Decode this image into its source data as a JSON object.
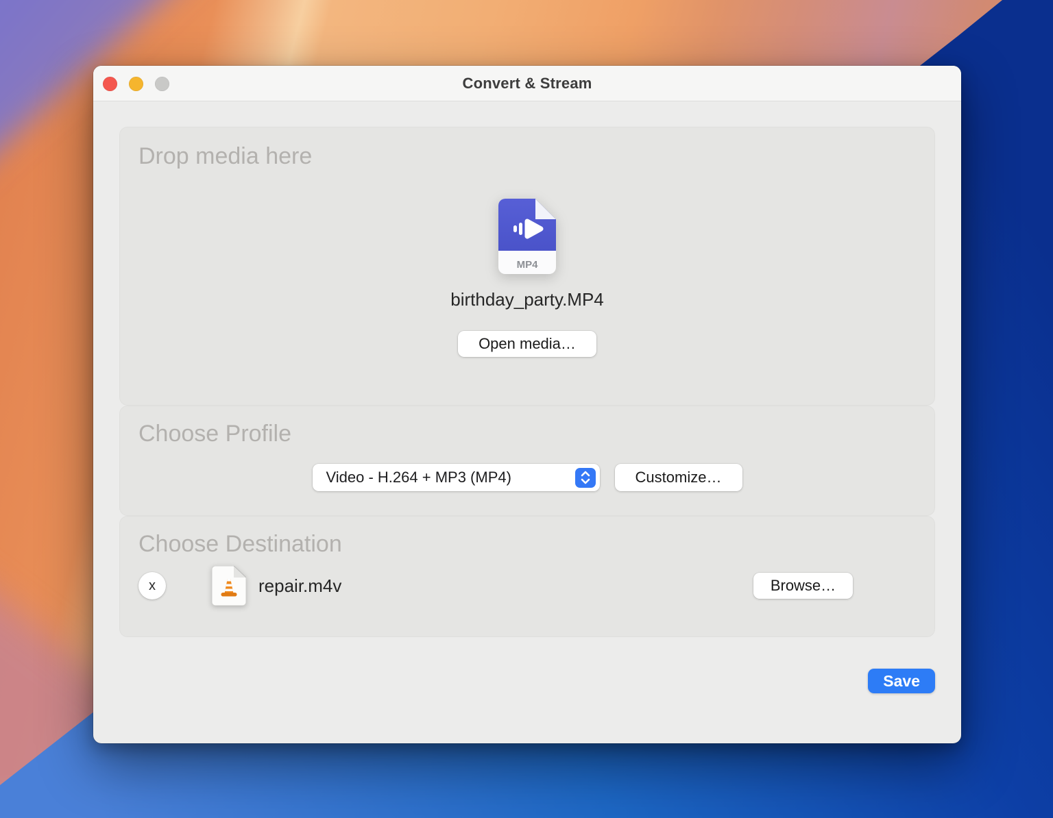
{
  "window": {
    "title": "Convert & Stream"
  },
  "drop_zone": {
    "heading": "Drop media here",
    "file_icon_label": "MP4",
    "file_name": "birthday_party.MP4",
    "open_media_label": "Open media…"
  },
  "profile": {
    "heading": "Choose Profile",
    "selected_option": "Video - H.264 + MP3 (MP4)",
    "customize_label": "Customize…"
  },
  "destination": {
    "heading": "Choose Destination",
    "remove_label": "x",
    "file_name": "repair.m4v",
    "browse_label": "Browse…"
  },
  "footer": {
    "save_label": "Save"
  },
  "colors": {
    "accent_blue": "#2d7cf6",
    "stepper_blue": "#3478f6",
    "mp4_icon_blue": "#4f58cf",
    "vlc_cone_orange": "#ef8a1e",
    "traffic_red": "#f4574e",
    "traffic_yellow": "#f5b52e",
    "traffic_gray": "#c9c9c7",
    "panel_gray": "#e5e5e3",
    "titlebar_gray": "#f6f6f5",
    "wallpaper_orange": "#efa468",
    "wallpaper_purple": "#7b74ca",
    "wallpaper_blue_dark": "#0a2f8e"
  }
}
